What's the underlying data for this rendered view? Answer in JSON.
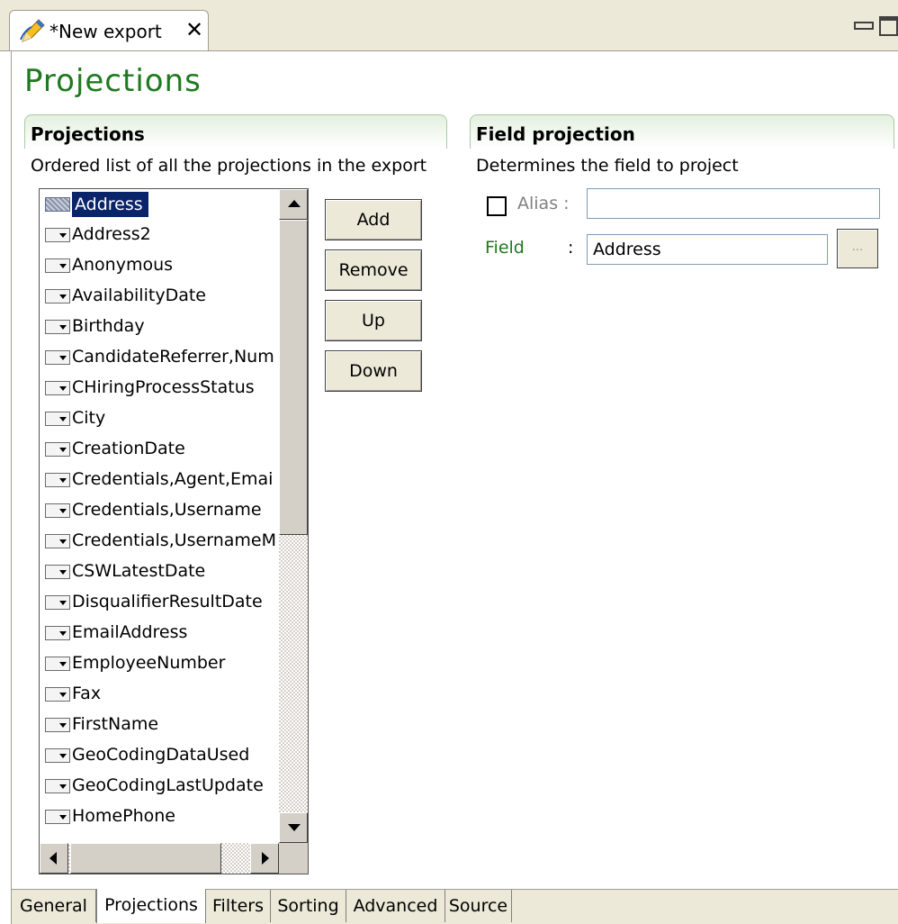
{
  "editor": {
    "tab_title": "*New export",
    "close_glyph": "✕",
    "tab_icon": "pencil-icon"
  },
  "page": {
    "title": "Projections"
  },
  "projections_section": {
    "header": "Projections",
    "description": "Ordered list of all the projections in the export",
    "items": [
      {
        "label": "Address",
        "selected": true
      },
      {
        "label": "Address2"
      },
      {
        "label": "Anonymous"
      },
      {
        "label": "AvailabilityDate"
      },
      {
        "label": "Birthday"
      },
      {
        "label": "CandidateReferrer,Num"
      },
      {
        "label": "CHiringProcessStatus"
      },
      {
        "label": "City"
      },
      {
        "label": "CreationDate"
      },
      {
        "label": "Credentials,Agent,Emai"
      },
      {
        "label": "Credentials,Username"
      },
      {
        "label": "Credentials,UsernameM"
      },
      {
        "label": "CSWLatestDate"
      },
      {
        "label": "DisqualifierResultDate"
      },
      {
        "label": "EmailAddress"
      },
      {
        "label": "EmployeeNumber"
      },
      {
        "label": "Fax"
      },
      {
        "label": "FirstName"
      },
      {
        "label": "GeoCodingDataUsed"
      },
      {
        "label": "GeoCodingLastUpdate"
      },
      {
        "label": "HomePhone"
      }
    ],
    "buttons": {
      "add": "Add",
      "remove": "Remove",
      "up": "Up",
      "down": "Down"
    }
  },
  "field_projection": {
    "header": "Field projection",
    "description": "Determines the field to project",
    "alias_label": "Alias  :",
    "alias_value": "",
    "alias_checked": false,
    "field_label": "Field",
    "field_colon": ":",
    "field_value": "Address",
    "browse_label": "..."
  },
  "bottom_tabs": [
    {
      "label": "General"
    },
    {
      "label": "Projections",
      "active": true
    },
    {
      "label": "Filters"
    },
    {
      "label": "Sorting"
    },
    {
      "label": "Advanced"
    },
    {
      "label": "Source"
    }
  ],
  "colors": {
    "title_green": "#1f7a1f",
    "selection": "#0a246a",
    "chrome": "#ece9d8"
  }
}
